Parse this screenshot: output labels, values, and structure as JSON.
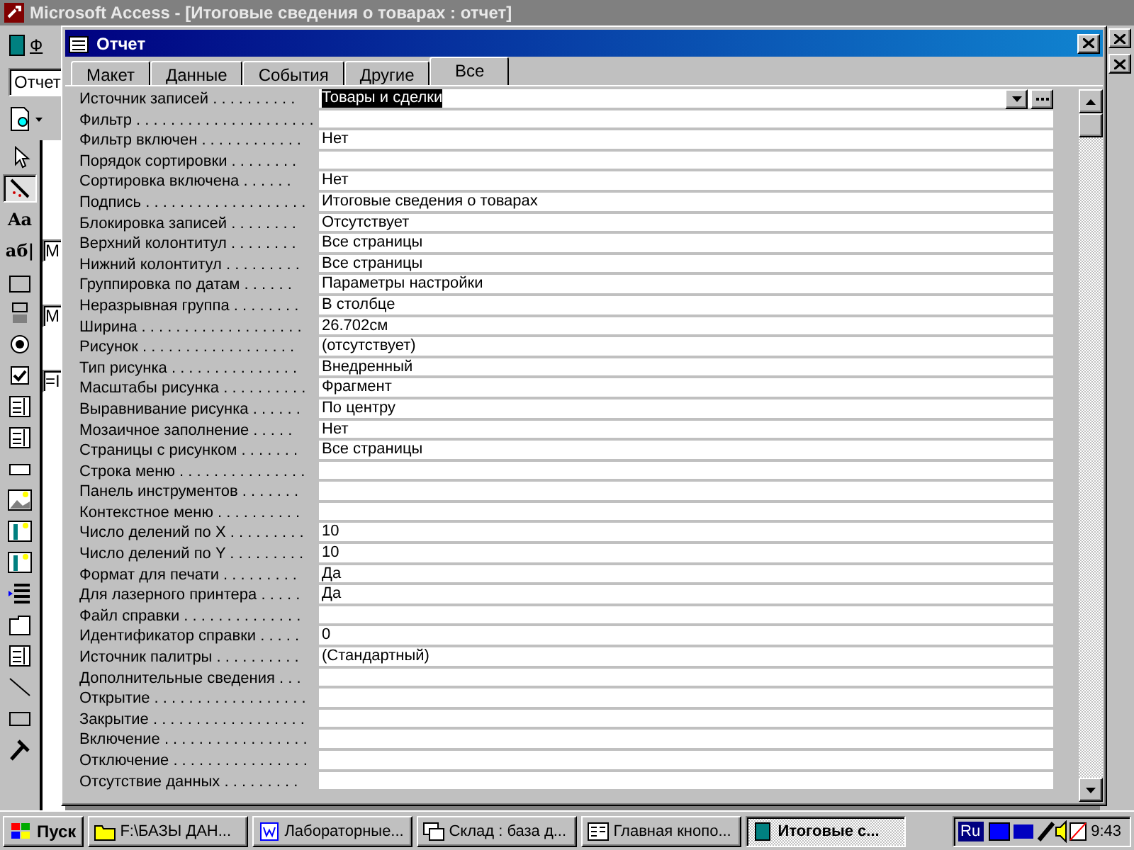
{
  "app": {
    "title": "Microsoft Access - [Итоговые сведения о товарах : отчет]",
    "menu_fragment": "Ф",
    "object_combo": "Отчет",
    "design_fragments": [
      "M",
      "M",
      "=I"
    ]
  },
  "toolbox": [
    {
      "kind": "pointer",
      "selected": false
    },
    {
      "kind": "wand",
      "selected": true
    },
    {
      "kind": "text",
      "label": "Aa",
      "selected": false
    },
    {
      "kind": "text",
      "label": "аб|",
      "selected": false
    },
    {
      "kind": "frame",
      "selected": false
    },
    {
      "kind": "toggle",
      "selected": false
    },
    {
      "kind": "radio",
      "selected": false
    },
    {
      "kind": "checkbox",
      "selected": false
    },
    {
      "kind": "combo",
      "selected": false
    },
    {
      "kind": "list",
      "selected": false
    },
    {
      "kind": "button",
      "selected": false
    },
    {
      "kind": "image",
      "selected": false
    },
    {
      "kind": "object",
      "selected": false
    },
    {
      "kind": "object",
      "selected": false
    },
    {
      "kind": "pagebreak",
      "selected": false
    },
    {
      "kind": "tab",
      "selected": false
    },
    {
      "kind": "list",
      "selected": false
    },
    {
      "kind": "line",
      "selected": false
    },
    {
      "kind": "rect",
      "selected": false
    },
    {
      "kind": "tools",
      "selected": false
    }
  ],
  "dialog": {
    "title": "Отчет",
    "tabs": [
      {
        "label": "Макет",
        "selected": false
      },
      {
        "label": "Данные",
        "selected": false
      },
      {
        "label": "События",
        "selected": false
      },
      {
        "label": "Другие",
        "selected": false
      },
      {
        "label": "Все",
        "selected": true
      }
    ],
    "properties": [
      {
        "label": "Источник записей . . . . . . . . . .",
        "value": "Товары и сделки",
        "selected": true
      },
      {
        "label": "Фильтр . . . . . . . . . . . . . . . . . . . . .",
        "selected": false
      },
      {
        "label": "Фильтр включен . . . . . . . . . . . .",
        "value": "Нет",
        "selected": false
      },
      {
        "label": "Порядок сортировки . . . . . . . .",
        "selected": false
      },
      {
        "label": "Сортировка включена . . . . . .",
        "value": "Нет",
        "selected": false
      },
      {
        "label": "Подпись . . . . . . . . . . . . . . . . . . .",
        "value": "Итоговые сведения о товарах",
        "selected": false
      },
      {
        "label": "Блокировка записей . . . . . . . .",
        "value": "Отсутствует",
        "selected": false
      },
      {
        "label": "Верхний колонтитул . . . . . . . .",
        "value": "Все страницы",
        "selected": false
      },
      {
        "label": "Нижний колонтитул . . . . . . . . .",
        "value": "Все страницы",
        "selected": false
      },
      {
        "label": "Группировка по датам . . . . . .",
        "value": "Параметры настройки",
        "selected": false
      },
      {
        "label": "Неразрывная группа . . . . . . . .",
        "value": "В столбце",
        "selected": false
      },
      {
        "label": "Ширина . . . . . . . . . . . . . . . . . . .",
        "value": "26.702см",
        "selected": false
      },
      {
        "label": "Рисунок . . . . . . . . . . . . . . . . . .",
        "value": "(отсутствует)",
        "selected": false
      },
      {
        "label": "Тип рисунка . . . . . . . . . . . . . . .",
        "value": "Внедренный",
        "selected": false
      },
      {
        "label": "Масштабы рисунка . . . . . . . . . .",
        "value": "Фрагмент",
        "selected": false
      },
      {
        "label": "Выравнивание рисунка . . . . . .",
        "value": "По центру",
        "selected": false
      },
      {
        "label": "Мозаичное заполнение . . . . .",
        "value": "Нет",
        "selected": false
      },
      {
        "label": "Страницы с рисунком . . . . . . .",
        "value": "Все страницы",
        "selected": false
      },
      {
        "label": "Строка меню . . . . . . . . . . . . . . .",
        "selected": false
      },
      {
        "label": "Панель инструментов . . . . . . .",
        "selected": false
      },
      {
        "label": "Контекстное меню . . . . . . . . . .",
        "selected": false
      },
      {
        "label": "Число делений по X . . . . . . . . .",
        "value": "10",
        "selected": false
      },
      {
        "label": "Число делений по Y . . . . . . . . .",
        "value": "10",
        "selected": false
      },
      {
        "label": "Формат для печати . . . . . . . . .",
        "value": "Да",
        "selected": false
      },
      {
        "label": "Для лазерного принтера . . . . .",
        "value": "Да",
        "selected": false
      },
      {
        "label": "Файл справки . . . . . . . . . . . . . .",
        "selected": false
      },
      {
        "label": "Идентификатор справки . . . . .",
        "value": "0",
        "selected": false
      },
      {
        "label": "Источник палитры . . . . . . . . . .",
        "value": "(Стандартный)",
        "selected": false
      },
      {
        "label": "Дополнительные сведения . . .",
        "selected": false
      },
      {
        "label": "Открытие . . . . . . . . . . . . . . . . . .",
        "selected": false
      },
      {
        "label": "Закрытие . . . . . . . . . . . . . . . . . .",
        "selected": false
      },
      {
        "label": "Включение . . . . . . . . . . . . . . . . .",
        "selected": false
      },
      {
        "label": "Отключение . . . . . . . . . . . . . . . .",
        "selected": false
      },
      {
        "label": "Отсутствие данных . . . . . . . . .",
        "selected": false
      }
    ]
  },
  "taskbar": {
    "start": "Пуск",
    "items": [
      {
        "label": "F:\\БАЗЫ ДАН...",
        "kind": "folder",
        "selected": false
      },
      {
        "label": "Лабораторные...",
        "kind": "word",
        "selected": false
      },
      {
        "label": "Склад : база д...",
        "kind": "windows",
        "selected": false
      },
      {
        "label": "Главная кнопо...",
        "kind": "form",
        "selected": false
      },
      {
        "label": "Итоговые с...",
        "kind": "book",
        "selected": true
      }
    ],
    "language": "Ru",
    "clock": "9:43"
  }
}
